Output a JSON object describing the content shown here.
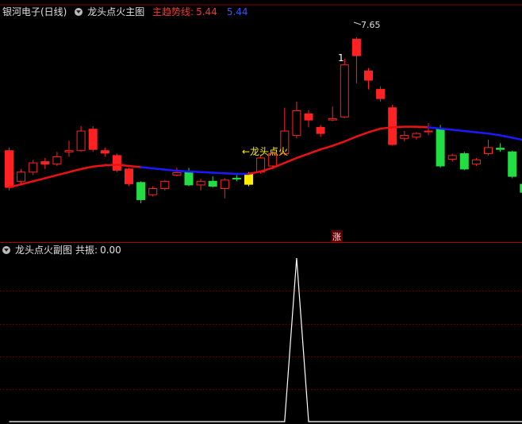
{
  "main_header": {
    "stock": "银河电子(日线)",
    "indicator": "龙头点火主图",
    "trend_label": "主趋势线:",
    "trend_value_red": "5.44",
    "trend_value_blue": "5.44"
  },
  "sub_header": {
    "indicator": "龙头点火副图",
    "resonance_label": "共振:",
    "resonance_value": "0.00"
  },
  "annotations": {
    "high_price": "7.65",
    "signal_text": "←龙头点火",
    "zhang_badge": "涨",
    "candle_digit": "1"
  },
  "colors": {
    "up": "#ff2222",
    "down": "#22dd44",
    "signal": "#ffee00",
    "trend_red": "#ee1111",
    "trend_blue": "#1a1aff",
    "grid": "#7a0000",
    "label_red": "#ff3333",
    "label_blue": "#3355ff"
  },
  "chart_data": [
    {
      "type": "candlestick",
      "title": "龙头点火主图",
      "note": "values are prices; candles listed left to right",
      "price_range": [
        4.5,
        8.0
      ],
      "candles": [
        {
          "o": 5.2,
          "c": 5.8,
          "h": 5.85,
          "l": 5.15,
          "kind": "up"
        },
        {
          "o": 5.3,
          "c": 5.45,
          "h": 5.5,
          "l": 5.25,
          "kind": "hollow"
        },
        {
          "o": 5.45,
          "c": 5.6,
          "h": 5.65,
          "l": 5.4,
          "kind": "hollow"
        },
        {
          "o": 5.62,
          "c": 5.58,
          "h": 5.68,
          "l": 5.5,
          "kind": "up"
        },
        {
          "o": 5.58,
          "c": 5.7,
          "h": 5.78,
          "l": 5.55,
          "kind": "hollow"
        },
        {
          "o": 5.78,
          "c": 5.8,
          "h": 5.96,
          "l": 5.7,
          "kind": "hollow"
        },
        {
          "o": 5.8,
          "c": 6.12,
          "h": 6.2,
          "l": 5.78,
          "kind": "hollow"
        },
        {
          "o": 6.15,
          "c": 5.82,
          "h": 6.2,
          "l": 5.78,
          "kind": "up"
        },
        {
          "o": 5.8,
          "c": 5.76,
          "h": 5.85,
          "l": 5.7,
          "kind": "up"
        },
        {
          "o": 5.72,
          "c": 5.48,
          "h": 5.75,
          "l": 5.45,
          "kind": "up"
        },
        {
          "o": 5.5,
          "c": 5.26,
          "h": 5.52,
          "l": 5.22,
          "kind": "up"
        },
        {
          "o": 5.28,
          "c": 5.0,
          "h": 5.3,
          "l": 4.94,
          "kind": "down"
        },
        {
          "o": 5.08,
          "c": 5.18,
          "h": 5.22,
          "l": 5.05,
          "kind": "hollow"
        },
        {
          "o": 5.18,
          "c": 5.3,
          "h": 5.32,
          "l": 5.15,
          "kind": "hollow"
        },
        {
          "o": 5.4,
          "c": 5.44,
          "h": 5.52,
          "l": 5.38,
          "kind": "hollow"
        },
        {
          "o": 5.44,
          "c": 5.24,
          "h": 5.52,
          "l": 5.22,
          "kind": "down"
        },
        {
          "o": 5.3,
          "c": 5.24,
          "h": 5.34,
          "l": 5.15,
          "kind": "hollow"
        },
        {
          "o": 5.3,
          "c": 5.22,
          "h": 5.38,
          "l": 5.2,
          "kind": "down"
        },
        {
          "o": 5.32,
          "c": 5.18,
          "h": 5.35,
          "l": 5.02,
          "kind": "hollow"
        },
        {
          "o": 5.35,
          "c": 5.35,
          "h": 5.4,
          "l": 5.3,
          "kind": "doji"
        },
        {
          "o": 5.25,
          "c": 5.42,
          "h": 5.45,
          "l": 5.22,
          "kind": "signal"
        },
        {
          "o": 5.45,
          "c": 5.68,
          "h": 5.72,
          "l": 5.42,
          "kind": "hollow"
        },
        {
          "o": 5.55,
          "c": 5.75,
          "h": 5.8,
          "l": 5.5,
          "kind": "hollow"
        },
        {
          "o": 5.75,
          "c": 6.12,
          "h": 6.5,
          "l": 5.72,
          "kind": "hollow"
        },
        {
          "o": 6.05,
          "c": 6.45,
          "h": 6.6,
          "l": 6.0,
          "kind": "hollow"
        },
        {
          "o": 6.4,
          "c": 6.3,
          "h": 6.46,
          "l": 6.18,
          "kind": "up"
        },
        {
          "o": 6.18,
          "c": 6.08,
          "h": 6.22,
          "l": 6.02,
          "kind": "up"
        },
        {
          "o": 6.3,
          "c": 6.32,
          "h": 6.52,
          "l": 6.28,
          "kind": "hollow"
        },
        {
          "o": 6.35,
          "c": 7.2,
          "h": 7.3,
          "l": 6.33,
          "kind": "hollow"
        },
        {
          "o": 7.35,
          "c": 7.62,
          "h": 7.65,
          "l": 6.9,
          "kind": "up"
        },
        {
          "o": 7.1,
          "c": 6.95,
          "h": 7.15,
          "l": 6.8,
          "kind": "up"
        },
        {
          "o": 6.8,
          "c": 6.65,
          "h": 6.85,
          "l": 6.6,
          "kind": "up"
        },
        {
          "o": 6.5,
          "c": 5.9,
          "h": 6.55,
          "l": 5.88,
          "kind": "up"
        },
        {
          "o": 6.0,
          "c": 6.05,
          "h": 6.12,
          "l": 5.95,
          "kind": "hollow"
        },
        {
          "o": 6.02,
          "c": 6.08,
          "h": 6.1,
          "l": 5.98,
          "kind": "hollow"
        },
        {
          "o": 6.12,
          "c": 6.12,
          "h": 6.25,
          "l": 6.05,
          "kind": "hollow"
        },
        {
          "o": 6.15,
          "c": 5.55,
          "h": 6.22,
          "l": 5.52,
          "kind": "down"
        },
        {
          "o": 5.66,
          "c": 5.72,
          "h": 5.75,
          "l": 5.62,
          "kind": "hollow"
        },
        {
          "o": 5.75,
          "c": 5.5,
          "h": 5.78,
          "l": 5.48,
          "kind": "down"
        },
        {
          "o": 5.58,
          "c": 5.65,
          "h": 5.68,
          "l": 5.55,
          "kind": "hollow"
        },
        {
          "o": 5.75,
          "c": 5.85,
          "h": 5.98,
          "l": 5.72,
          "kind": "hollow"
        },
        {
          "o": 5.82,
          "c": 5.84,
          "h": 5.92,
          "l": 5.78,
          "kind": "doji"
        },
        {
          "o": 5.78,
          "c": 5.38,
          "h": 5.8,
          "l": 5.35,
          "kind": "down"
        },
        {
          "o": 5.25,
          "c": 5.12,
          "h": 5.28,
          "l": 5.1,
          "kind": "down"
        }
      ],
      "trend_line": [
        5.2,
        5.25,
        5.3,
        5.35,
        5.4,
        5.45,
        5.5,
        5.54,
        5.56,
        5.57,
        5.55,
        5.53,
        5.51,
        5.49,
        5.47,
        5.46,
        5.45,
        5.44,
        5.43,
        5.42,
        5.42,
        5.46,
        5.52,
        5.6,
        5.68,
        5.75,
        5.82,
        5.88,
        5.95,
        6.03,
        6.1,
        6.16,
        6.18,
        6.19,
        6.19,
        6.18,
        6.16,
        6.14,
        6.12,
        6.1,
        6.08,
        6.05,
        6.01,
        5.97
      ],
      "trend_blue_ranges": [
        [
          11,
          20
        ],
        [
          35,
          43
        ]
      ]
    },
    {
      "type": "line",
      "title": "龙头点火副图",
      "series": [
        {
          "name": "共振",
          "values": [
            0,
            0,
            0,
            0,
            0,
            0,
            0,
            0,
            0,
            0,
            0,
            0,
            0,
            0,
            0,
            0,
            0,
            0,
            0,
            0,
            0,
            0,
            0,
            0,
            1,
            0,
            0,
            0,
            0,
            0,
            0,
            0,
            0,
            0,
            0,
            0,
            0,
            0,
            0,
            0,
            0,
            0,
            0,
            0
          ]
        }
      ],
      "ylim": [
        0,
        1
      ]
    }
  ]
}
